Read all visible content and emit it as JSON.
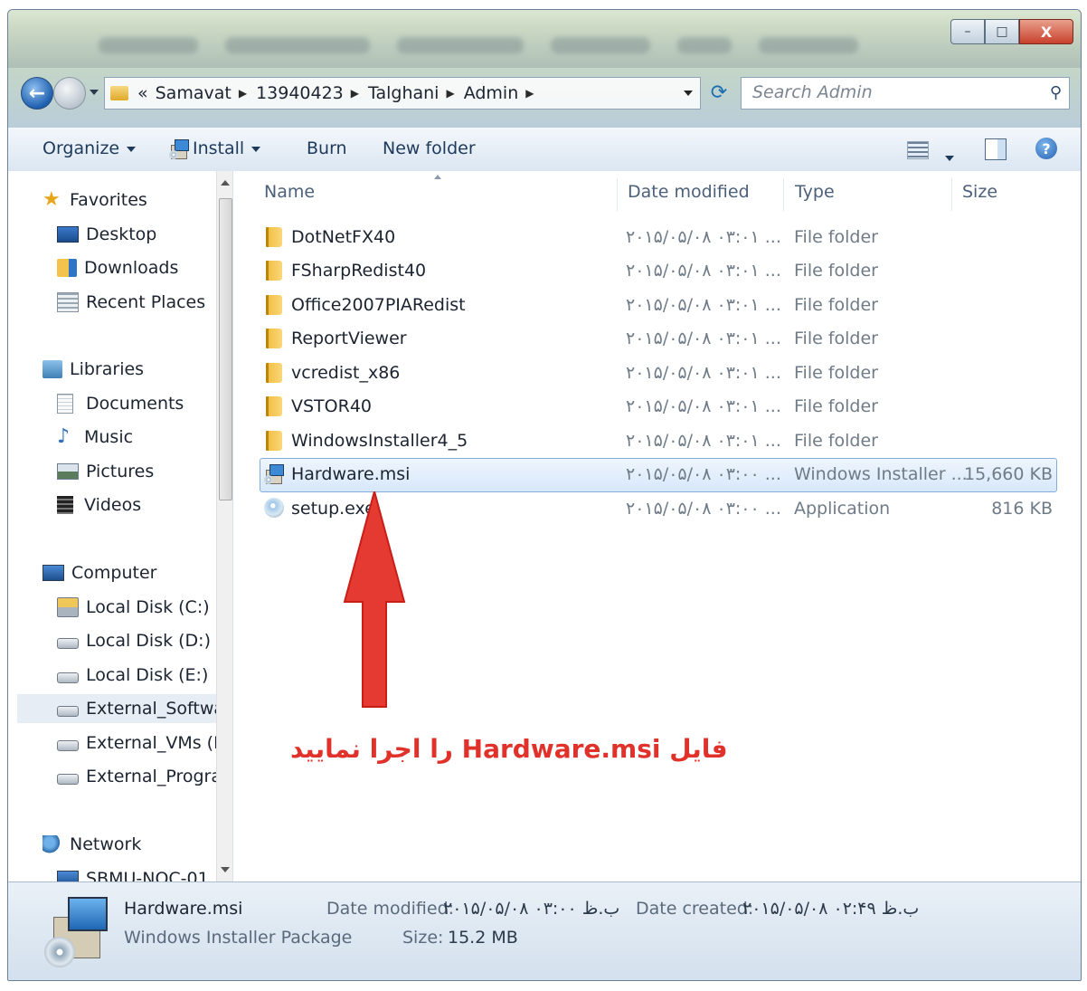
{
  "window": {
    "controls": {
      "minimize": "–",
      "maximize": "□",
      "close": "X"
    }
  },
  "address": {
    "prefix": "«",
    "segments": [
      "Samavat",
      "13940423",
      "Talghani",
      "Admin"
    ],
    "search_placeholder": "Search Admin"
  },
  "toolbar": {
    "organize": "Organize",
    "install": "Install",
    "burn": "Burn",
    "new_folder": "New folder"
  },
  "nav": {
    "favorites": "Favorites",
    "desktop": "Desktop",
    "downloads": "Downloads",
    "recent": "Recent Places",
    "libraries": "Libraries",
    "documents": "Documents",
    "music": "Music",
    "pictures": "Pictures",
    "videos": "Videos",
    "computer": "Computer",
    "disk_c": "Local Disk (C:)",
    "disk_d": "Local Disk (D:)",
    "disk_e": "Local Disk (E:)",
    "ext_software": "External_Software",
    "ext_vms": "External_VMs (H:)",
    "ext_program": "External_Programs",
    "network": "Network",
    "net_host": "SBMU-NOC-01"
  },
  "columns": {
    "name": "Name",
    "date": "Date modified",
    "type": "Type",
    "size": "Size"
  },
  "files": [
    {
      "name": "DotNetFX40",
      "date": "۲۰۱۵/۰۵/۰۸ ۰۳:۰۱ ...",
      "type": "File folder",
      "size": ""
    },
    {
      "name": "FSharpRedist40",
      "date": "۲۰۱۵/۰۵/۰۸ ۰۳:۰۱ ...",
      "type": "File folder",
      "size": ""
    },
    {
      "name": "Office2007PIARedist",
      "date": "۲۰۱۵/۰۵/۰۸ ۰۳:۰۱ ...",
      "type": "File folder",
      "size": ""
    },
    {
      "name": "ReportViewer",
      "date": "۲۰۱۵/۰۵/۰۸ ۰۳:۰۱ ...",
      "type": "File folder",
      "size": ""
    },
    {
      "name": "vcredist_x86",
      "date": "۲۰۱۵/۰۵/۰۸ ۰۳:۰۱ ...",
      "type": "File folder",
      "size": ""
    },
    {
      "name": "VSTOR40",
      "date": "۲۰۱۵/۰۵/۰۸ ۰۳:۰۱ ...",
      "type": "File folder",
      "size": ""
    },
    {
      "name": "WindowsInstaller4_5",
      "date": "۲۰۱۵/۰۵/۰۸ ۰۳:۰۱ ...",
      "type": "File folder",
      "size": ""
    },
    {
      "name": "Hardware.msi",
      "date": "۲۰۱۵/۰۵/۰۸ ۰۳:۰۰ ...",
      "type": "Windows Installer ...",
      "size": "15,660 KB"
    },
    {
      "name": "setup.exe",
      "date": "۲۰۱۵/۰۵/۰۸ ۰۳:۰۰ ...",
      "type": "Application",
      "size": "816 KB"
    }
  ],
  "annotation": "فایل Hardware.msi را اجرا نمایید",
  "details": {
    "name": "Hardware.msi",
    "kind": "Windows Installer Package",
    "modified_label": "Date modified:",
    "modified_value": "۲۰۱۵/۰۵/۰۸ ب.ظ ۰۳:۰۰",
    "size_label": "Size:",
    "size_value": "15.2 MB",
    "created_label": "Date created:",
    "created_value": "۲۰۱۵/۰۵/۰۸ ب.ظ ۰۲:۴۹"
  },
  "colors": {
    "annotation_red": "#e0322a",
    "selection_border": "#84acdd"
  }
}
